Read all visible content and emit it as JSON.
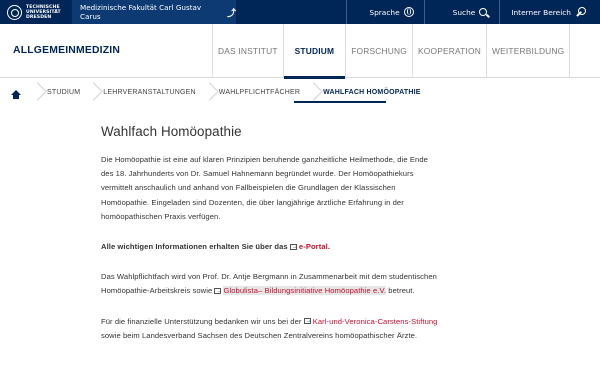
{
  "topbar": {
    "logo_lines": [
      "TECHNISCHE",
      "UNIVERSITÄT",
      "DRESDEN"
    ],
    "faculty": "Medizinische Fakultät Carl Gustav Carus",
    "faculty_icon": "⤴",
    "links": [
      {
        "label": "Sprache",
        "icon": "globe-icon"
      },
      {
        "label": "Suche",
        "icon": "search-icon"
      },
      {
        "label": "Interner Bereich",
        "icon": "key-icon"
      }
    ]
  },
  "header": {
    "site_title": "ALLGEMEINMEDIZIN",
    "nav": [
      "DAS INSTITUT",
      "STUDIUM",
      "FORSCHUNG",
      "KOOPERATION",
      "WEITERBILDUNG"
    ],
    "active_nav": "STUDIUM"
  },
  "breadcrumb": {
    "home_icon": "home-icon",
    "items": [
      "STUDIUM",
      "LEHRVERANSTALTUNGEN",
      "WAHLPFLICHTFÄCHER",
      "WAHLFACH HOMÖOPATHIE"
    ]
  },
  "content": {
    "title": "Wahlfach Homöopathie",
    "intro": "Die Homöopathie ist eine auf klaren Prinzipien beruhende ganzheitliche Heilmethode, die Ende des 18. Jahrhunderts von Dr. Samuel Hahnemann begründet wurde. Der Homöopathiekurs vermittelt anschaulich und anhand von Fallbeispielen die Grundlagen der Klassischen Homöopathie. Eingeladen sind Dozenten, die über langjährige ärztliche Erfahrung in der homöopathischen Praxis verfügen.",
    "info_prefix": "Alle wichtigen Informationen erhalten Sie über das ",
    "info_link": "e-Portal",
    "info_suffix": ".",
    "p3_prefix": "Das Wahlpflichtfach wird von Prof. Dr. Antje Bergmann in Zusammenarbeit mit dem studentischen Homöopathie-Arbeitskreis sowie ",
    "p3_link": "Globulista– Bildungsinitiative Homöopathie e.V.",
    "p3_suffix": " betreut.",
    "p4_prefix": "Für die finanzielle Unterstützung bedanken wir uns bei der ",
    "p4_link": "Karl-und-Veronica-Carstens-Stiftung",
    "p4_suffix": " sowie beim Landesverband Sachsen des Deutschen Zentralvereins homöopathischer Ärzte."
  },
  "colors": {
    "brand_navy": "#002557",
    "link_red": "#c4122f"
  }
}
